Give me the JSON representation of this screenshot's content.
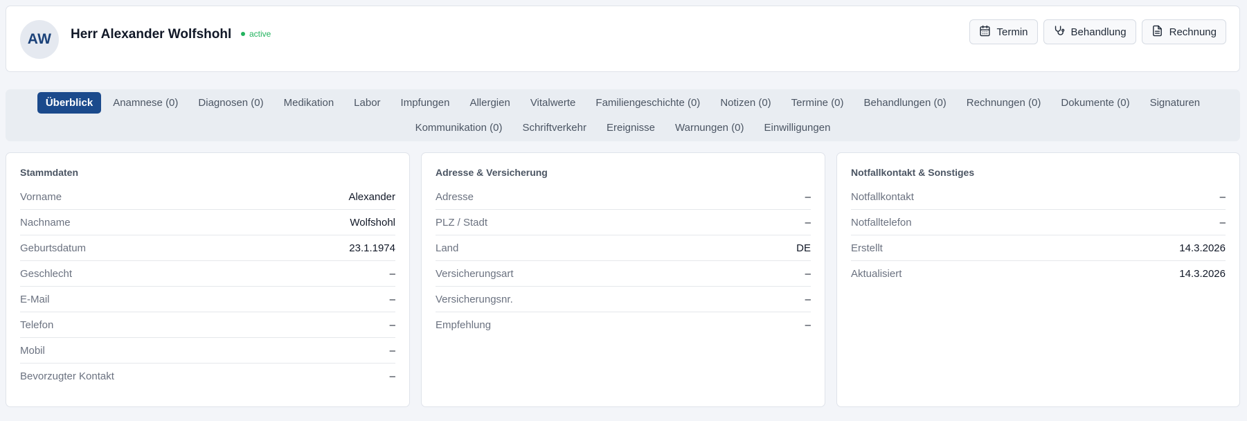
{
  "patient": {
    "initials": "AW",
    "name": "Herr Alexander Wolfshohl",
    "status": "active",
    "status_color": "#22b35e"
  },
  "actions": [
    {
      "label": "Termin",
      "icon": "calendar-icon"
    },
    {
      "label": "Behandlung",
      "icon": "stethoscope-icon"
    },
    {
      "label": "Rechnung",
      "icon": "invoice-icon"
    }
  ],
  "tabs": {
    "row1": [
      {
        "label": "Überblick",
        "active": true
      },
      {
        "label": "Anamnese (0)"
      },
      {
        "label": "Diagnosen (0)"
      },
      {
        "label": "Medikation"
      },
      {
        "label": "Labor"
      },
      {
        "label": "Impfungen"
      },
      {
        "label": "Allergien"
      },
      {
        "label": "Vitalwerte"
      },
      {
        "label": "Familiengeschichte (0)"
      },
      {
        "label": "Notizen (0)"
      },
      {
        "label": "Termine (0)"
      },
      {
        "label": "Behandlungen (0)"
      },
      {
        "label": "Rechnungen (0)"
      },
      {
        "label": "Dokumente (0)"
      },
      {
        "label": "Signaturen"
      }
    ],
    "row2": [
      {
        "label": "Kommunikation (0)"
      },
      {
        "label": "Schriftverkehr"
      },
      {
        "label": "Ereignisse"
      },
      {
        "label": "Warnungen (0)"
      },
      {
        "label": "Einwilligungen"
      }
    ]
  },
  "cards": {
    "stammdaten": {
      "title": "Stammdaten",
      "rows": [
        {
          "label": "Vorname",
          "value": "Alexander"
        },
        {
          "label": "Nachname",
          "value": "Wolfshohl"
        },
        {
          "label": "Geburtsdatum",
          "value": "23.1.1974"
        },
        {
          "label": "Geschlecht",
          "value": "–"
        },
        {
          "label": "E-Mail",
          "value": "–"
        },
        {
          "label": "Telefon",
          "value": "–"
        },
        {
          "label": "Mobil",
          "value": "–"
        },
        {
          "label": "Bevorzugter Kontakt",
          "value": "–"
        }
      ]
    },
    "adresse": {
      "title": "Adresse & Versicherung",
      "rows": [
        {
          "label": "Adresse",
          "value": "–"
        },
        {
          "label": "PLZ / Stadt",
          "value": "–"
        },
        {
          "label": "Land",
          "value": "DE"
        },
        {
          "label": "Versicherungsart",
          "value": "–"
        },
        {
          "label": "Versicherungsnr.",
          "value": "–"
        },
        {
          "label": "Empfehlung",
          "value": "–"
        }
      ]
    },
    "notfall": {
      "title": "Notfallkontakt & Sonstiges",
      "rows": [
        {
          "label": "Notfallkontakt",
          "value": "–"
        },
        {
          "label": "Notfalltelefon",
          "value": "–"
        },
        {
          "label": "Erstellt",
          "value": "14.3.2026"
        },
        {
          "label": "Aktualisiert",
          "value": "14.3.2026"
        }
      ]
    }
  }
}
